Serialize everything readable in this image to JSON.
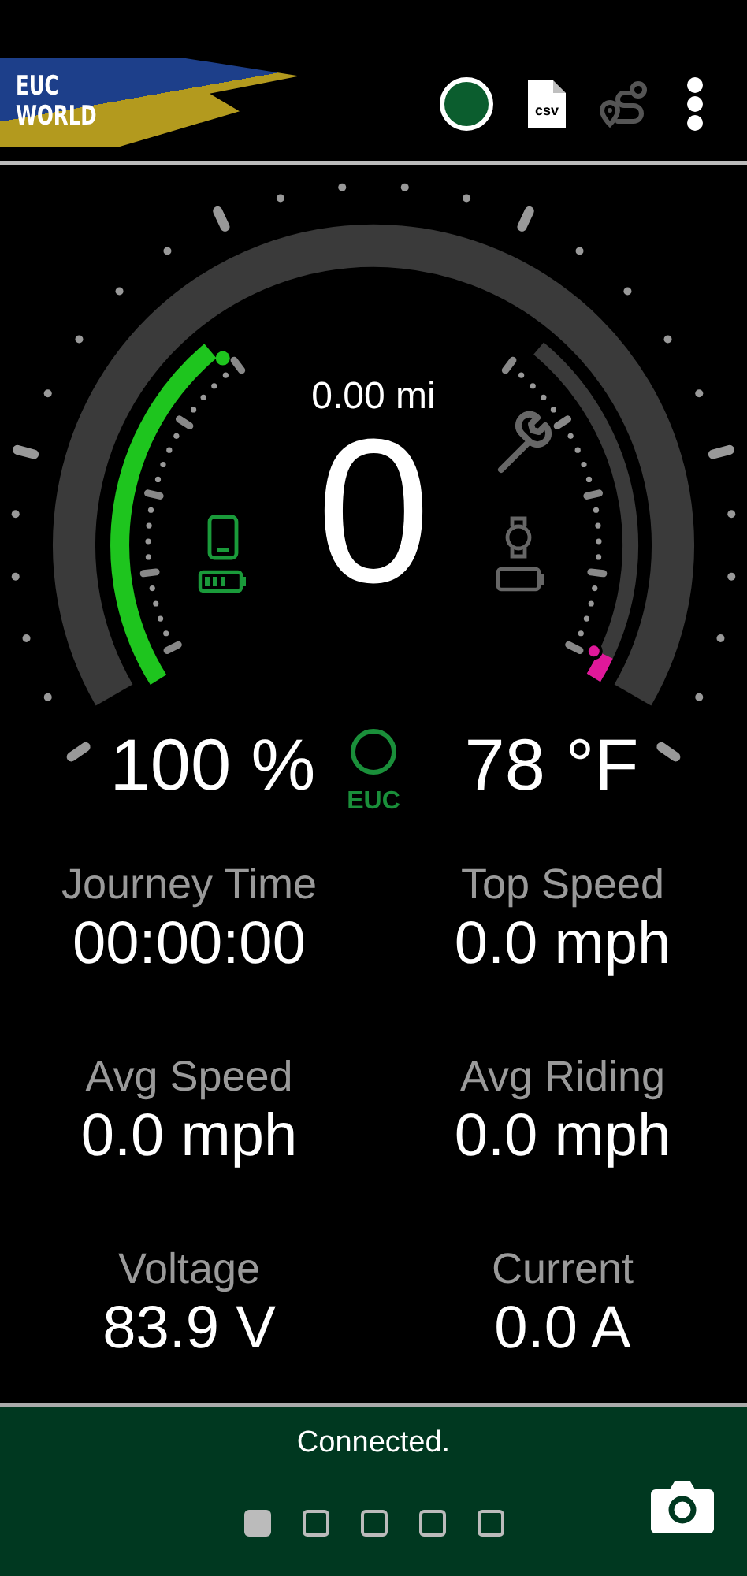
{
  "header": {
    "logo": [
      "EUC",
      "WORLD"
    ],
    "actions": [
      {
        "kind": "record"
      },
      {
        "kind": "csv",
        "label": "csv",
        "disabled": false
      },
      {
        "kind": "route",
        "disabled": true
      },
      {
        "kind": "menu"
      }
    ]
  },
  "gauge": {
    "distance": "0.00 mi",
    "speed": "0",
    "battery": {
      "reading": "100 %"
    },
    "temperature": {
      "reading": "78 °F"
    },
    "device_label": "EUC"
  },
  "stats": [
    {
      "label": "Journey Time",
      "value": "00:00:00"
    },
    {
      "label": "Top Speed",
      "value": "0.0 mph"
    },
    {
      "label": "Avg Speed",
      "value": "0.0 mph"
    },
    {
      "label": "Avg Riding",
      "value": "0.0 mph"
    },
    {
      "label": "Voltage",
      "value": "83.9 V"
    },
    {
      "label": "Current",
      "value": "0.0 A"
    }
  ],
  "footer": {
    "status": "Connected.",
    "pages": [
      {
        "selected": true
      },
      {
        "selected": false
      },
      {
        "selected": false
      },
      {
        "selected": false
      },
      {
        "selected": false
      }
    ]
  }
}
